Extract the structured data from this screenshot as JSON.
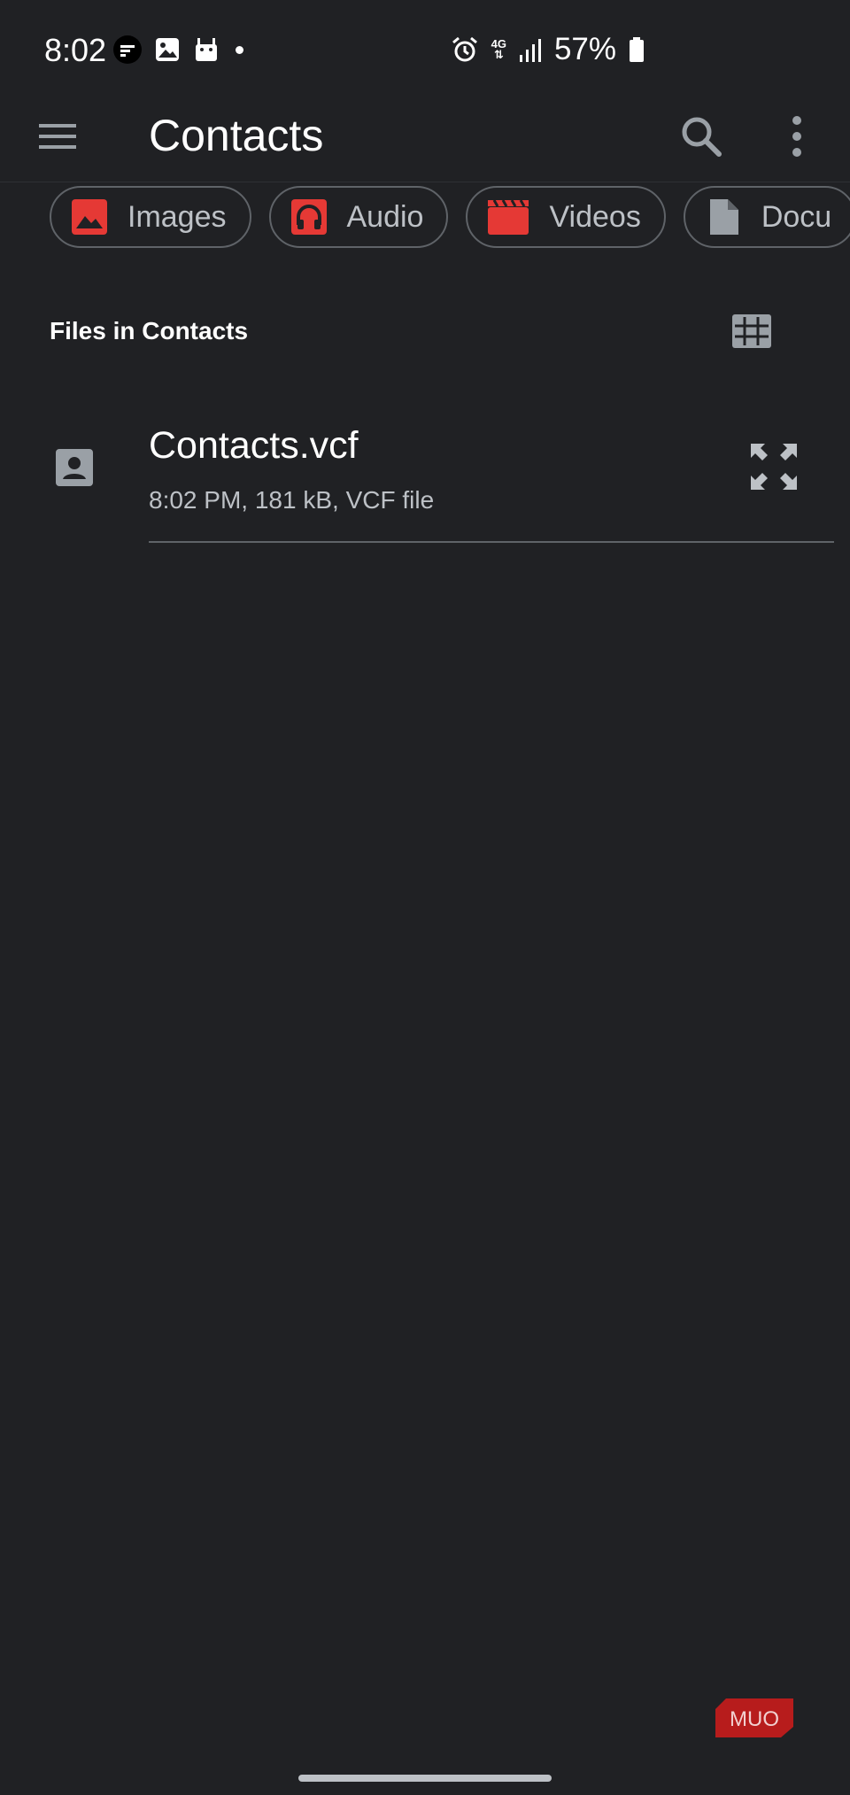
{
  "status_bar": {
    "time": "8:02",
    "notification_icons": [
      "flipboard-icon",
      "gallery-icon",
      "android-icon",
      "dot-icon"
    ],
    "system_icons": [
      "alarm-icon",
      "network-4g-icon",
      "signal-icon",
      "battery-icon"
    ],
    "network_label": "4G",
    "battery_percent": "57%"
  },
  "app_bar": {
    "title": "Contacts",
    "menu_icon": "hamburger-menu-icon",
    "search_icon": "search-icon",
    "overflow_icon": "more-vert-icon"
  },
  "filter_chips": [
    {
      "label": "Images",
      "icon": "image-icon",
      "icon_color": "#e53935"
    },
    {
      "label": "Audio",
      "icon": "headphones-icon",
      "icon_color": "#e53935"
    },
    {
      "label": "Videos",
      "icon": "movie-icon",
      "icon_color": "#e53935"
    },
    {
      "label": "Docu",
      "icon": "document-icon",
      "icon_color": "#9aa0a6"
    }
  ],
  "section": {
    "title": "Files in Contacts",
    "view_toggle_icon": "grid-view-icon"
  },
  "files": [
    {
      "name": "Contacts.vcf",
      "meta": "8:02 PM, 181 kB, VCF file",
      "icon": "contact-card-icon",
      "action_icon": "expand-icon"
    }
  ],
  "watermark": {
    "text": "MUO",
    "color": "#b71c1c"
  },
  "colors": {
    "background": "#202124",
    "accent": "#e53935",
    "text_primary": "#ffffff",
    "text_secondary": "#bdc1c6",
    "outline": "#5f6368"
  }
}
